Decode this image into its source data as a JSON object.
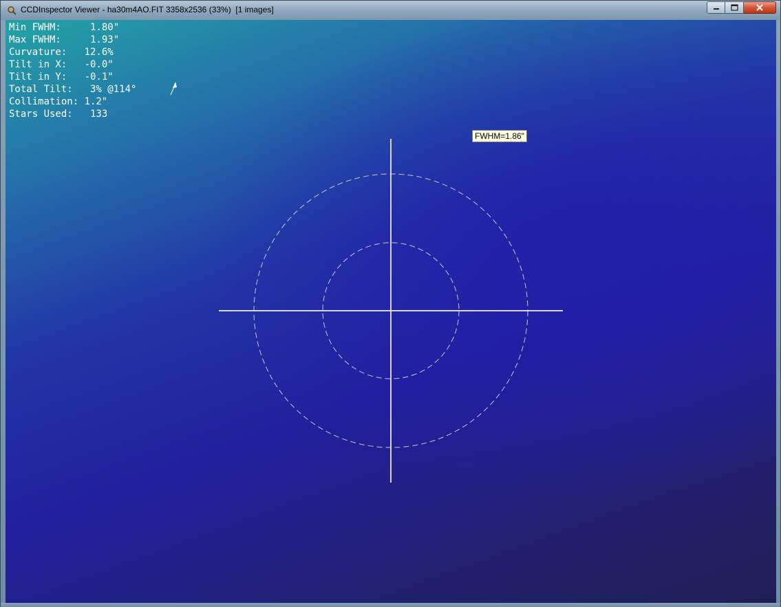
{
  "window": {
    "title": "CCDInspector Viewer - ha30m4AO.FIT 3358x2536 (33%)  [1 images]",
    "icon": "ccdinspector-app-icon",
    "controls": [
      "minimize-icon",
      "maximize-icon",
      "close-icon"
    ]
  },
  "stats": [
    {
      "label": "Min FWHM:",
      "value": "1.80\""
    },
    {
      "label": "Max FWHM:",
      "value": "1.93\""
    },
    {
      "label": "Curvature:",
      "value": "12.6%"
    },
    {
      "label": "Tilt in X:",
      "value": "-0.0\""
    },
    {
      "label": "Tilt in Y:",
      "value": "-0.1\""
    },
    {
      "label": "Total Tilt:",
      "value": "3% @114°"
    },
    {
      "label": "Collimation:",
      "value": "1.2\""
    },
    {
      "label": "Stars Used:",
      "value": "133"
    }
  ],
  "stat_lines": [
    "Min FWHM:     1.80\"",
    "Max FWHM:     1.93\"",
    "Curvature:   12.6%",
    "Tilt in X:   -0.0\"",
    "Tilt in Y:   -0.1\"",
    "Total Tilt:   3% @114°",
    "Collimation: 1.2\"",
    "Stars Used:   133"
  ],
  "tilt_indicator": {
    "angle_deg": 114,
    "icon": "tilt-arrow-icon"
  },
  "tooltip": {
    "text": "FWHM=1.86\""
  },
  "colors": {
    "background_top_left": "#23a3a5",
    "background_center": "#221f9e",
    "background_bottom_right": "#1f1f55",
    "overlay_lines": "#d8d8e8",
    "text": "#ffffff",
    "tooltip_bg": "#ffffe1"
  }
}
